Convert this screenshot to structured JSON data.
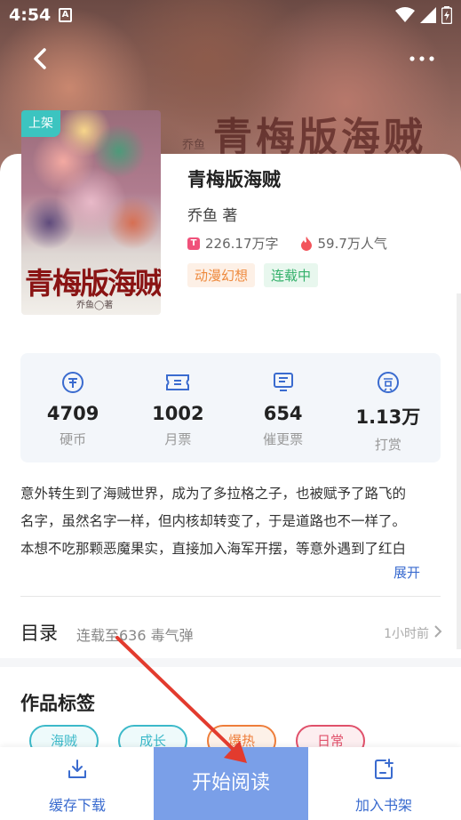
{
  "status_bar": {
    "time": "4:54",
    "notification_letter": "A"
  },
  "hero": {
    "title": "青梅版海贼",
    "author": "乔鱼"
  },
  "cover": {
    "badge": "上架",
    "title": "青梅版海贼",
    "author": "乔鱼◯著"
  },
  "book": {
    "title": "青梅版海贼",
    "author": "乔鱼 著",
    "word_count": "226.17万字",
    "popularity": "59.7万人气",
    "tags": [
      "动漫幻想",
      "连载中"
    ]
  },
  "stats": [
    {
      "icon": "coin-icon",
      "value": "4709",
      "label": "硬币"
    },
    {
      "icon": "ticket-icon",
      "value": "1002",
      "label": "月票"
    },
    {
      "icon": "update-request-icon",
      "value": "654",
      "label": "催更票"
    },
    {
      "icon": "tip-icon",
      "value": "1.13万",
      "label": "打赏"
    }
  ],
  "description": {
    "lines": [
      "意外转生到了海贼世界，成为了多拉格之子，也被赋予了路飞的",
      "名字，虽然名字一样，但内核却转变了，于是道路也不一样了。",
      "本想不吃那颗恶魔果实，直接加入海军开摆，等意外遇到了红白"
    ],
    "expand_label": "展开"
  },
  "toc": {
    "title": "目录",
    "latest": "连载至636 毒气弹",
    "time": "1小时前"
  },
  "work_tags": {
    "title": "作品标签",
    "items": [
      "海贼",
      "成长",
      "爆热",
      "日常"
    ],
    "colors": [
      "#3cb9c9",
      "#3cb9c9",
      "#ee7d3a",
      "#e0506a"
    ]
  },
  "bottom_bar": {
    "download": "缓存下载",
    "read": "开始阅读",
    "add_shelf": "加入书架"
  },
  "colors": {
    "accent": "#3a6bcf",
    "read_button": "#7a9fe8",
    "arrow": "#e23b2e"
  }
}
